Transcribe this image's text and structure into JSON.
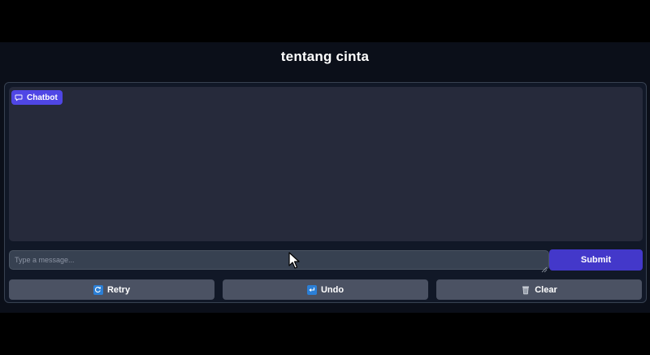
{
  "app": {
    "title": "tentang cinta"
  },
  "chatbot": {
    "label": "Chatbot",
    "label_icon": "chat-bubble-icon"
  },
  "input": {
    "placeholder": "Type a message..."
  },
  "submit": {
    "label": "Submit"
  },
  "actions": [
    {
      "label": "Retry",
      "icon": "retry-icon"
    },
    {
      "label": "Undo",
      "icon": "undo-icon"
    },
    {
      "label": "Clear",
      "icon": "trash-icon"
    }
  ],
  "colors": {
    "background": "#0b0f19",
    "panel": "#111827",
    "chat_area": "#262a3b",
    "accent": "#4f46e5",
    "submit": "#4338ca",
    "secondary_button": "#4b5263"
  }
}
